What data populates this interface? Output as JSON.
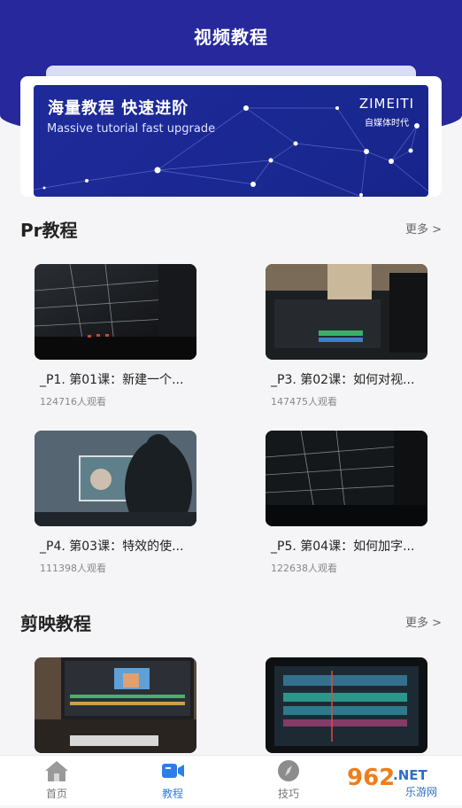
{
  "header": {
    "title": "视频教程"
  },
  "banner": {
    "title": "海量教程  快速进阶",
    "subtitle": "Massive tutorial fast upgrade",
    "brand": "ZIMEITI",
    "brand_sub": "自媒体时代"
  },
  "sections": [
    {
      "title": "Pr教程",
      "more": "更多 >",
      "cards": [
        {
          "title": "_P1. 第01课：新建一个...",
          "views": "124716人观看"
        },
        {
          "title": "_P3. 第02课：如何对视...",
          "views": "147475人观看"
        },
        {
          "title": "_P4. 第03课：特效的使...",
          "views": "111398人观看"
        },
        {
          "title": "_P5. 第04课：如何加字...",
          "views": "122638人观看"
        }
      ]
    },
    {
      "title": "剪映教程",
      "more": "更多 >",
      "cards": []
    }
  ],
  "tabbar": {
    "items": [
      {
        "label": "首页",
        "icon": "home-icon",
        "active": false
      },
      {
        "label": "教程",
        "icon": "video-camera-icon",
        "active": true
      },
      {
        "label": "技巧",
        "icon": "compass-icon",
        "active": false
      }
    ],
    "accent": "#2f7ee8"
  },
  "watermark": {
    "text_a": "962",
    "text_b": ".NET",
    "text_c": "乐游网"
  }
}
